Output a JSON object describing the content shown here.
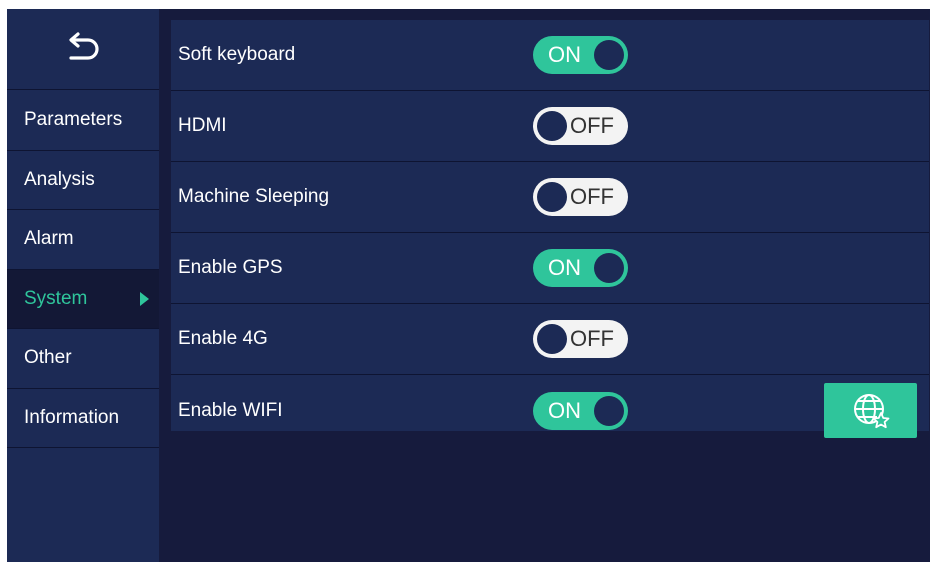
{
  "sidebar": {
    "items": [
      {
        "label": "Parameters",
        "active": false
      },
      {
        "label": "Analysis",
        "active": false
      },
      {
        "label": "Alarm",
        "active": false
      },
      {
        "label": "System",
        "active": true
      },
      {
        "label": "Other",
        "active": false
      },
      {
        "label": "Information",
        "active": false
      }
    ]
  },
  "settings": {
    "rows": [
      {
        "label": "Soft keyboard",
        "toggle": "ON"
      },
      {
        "label": "HDMI",
        "toggle": "OFF"
      },
      {
        "label": "Machine Sleeping",
        "toggle": "OFF"
      },
      {
        "label": "Enable GPS",
        "toggle": "ON"
      },
      {
        "label": "Enable 4G",
        "toggle": "OFF"
      },
      {
        "label": "Enable WIFI",
        "toggle": "ON"
      }
    ]
  },
  "icons": {
    "back": "back-arrow-icon",
    "nav_active": "triangle-right-icon",
    "wifi_settings": "globe-star-icon"
  },
  "colors": {
    "accent": "#2fc59b",
    "panel": "#1c2a55",
    "background": "#161b3d"
  }
}
